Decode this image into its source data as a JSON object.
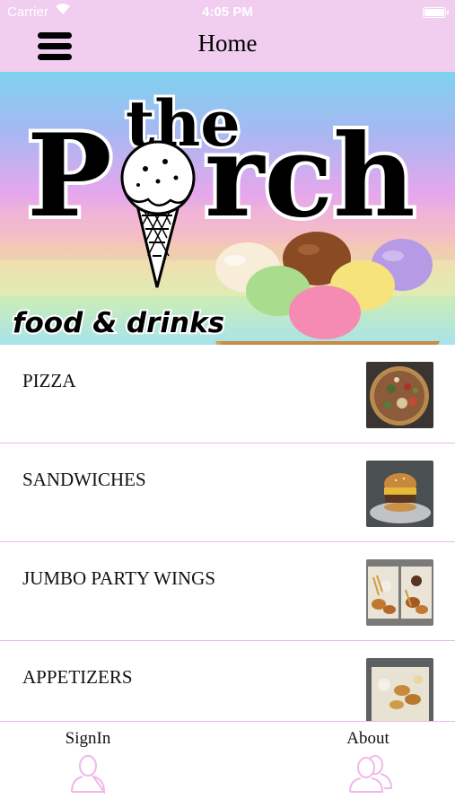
{
  "status_bar": {
    "carrier": "Carrier",
    "time": "4:05 PM"
  },
  "nav": {
    "title": "Home",
    "menu_icon": "hamburger-menu-icon"
  },
  "banner": {
    "logo_the": "the",
    "logo_name_left": "P",
    "logo_name_right": "rch",
    "tagline": "food & drinks"
  },
  "menu_items": [
    {
      "label": "PIZZA"
    },
    {
      "label": "SANDWICHES"
    },
    {
      "label": "JUMBO PARTY WINGS"
    },
    {
      "label": "APPETIZERS"
    }
  ],
  "tabs": [
    {
      "label": "SignIn",
      "icon": "person-icon"
    },
    {
      "label": "About",
      "icon": "people-icon"
    }
  ],
  "colors": {
    "bar_background": "#f1cdf0",
    "divider": "#e9b9e6",
    "tab_icon": "#f0b8e8"
  }
}
